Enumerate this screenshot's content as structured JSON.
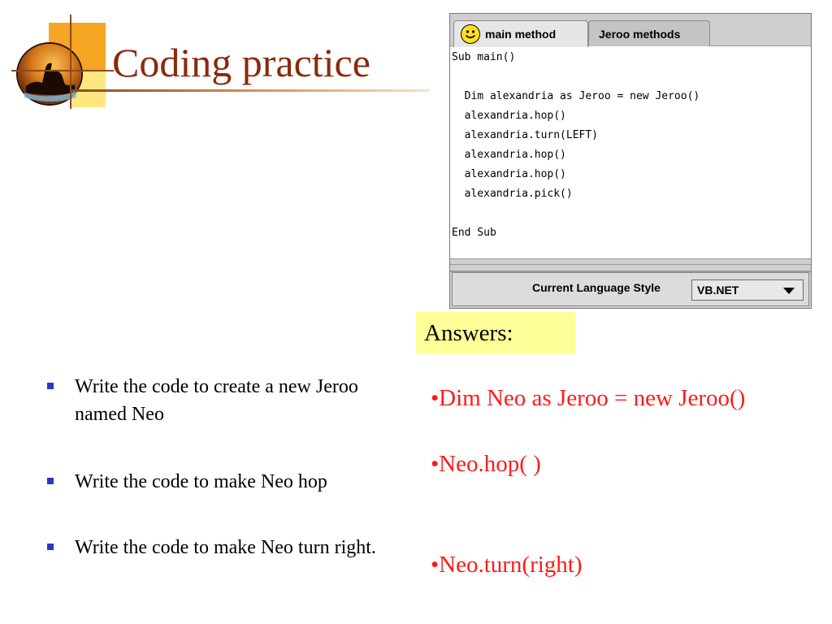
{
  "title": "Coding practice",
  "colors": {
    "title": "#8b2a0d",
    "answer_text": "#ff1a1a",
    "answers_highlight": "#ffff99",
    "bullet": "#2a36c8"
  },
  "app": {
    "tabs": [
      {
        "label": "main method",
        "icon": "smiley-icon",
        "active": true
      },
      {
        "label": "Jeroo methods",
        "active": false
      }
    ],
    "code_lines": [
      "Sub main()",
      "",
      "  Dim alexandria as Jeroo = new Jeroo()",
      "  alexandria.hop()",
      "  alexandria.turn(LEFT)",
      "  alexandria.hop()",
      "  alexandria.hop()",
      "  alexandria.pick()",
      "",
      "End Sub"
    ],
    "language_label": "Current Language Style",
    "language_value": "VB.NET"
  },
  "answers_header": "Answers:",
  "questions": [
    "Write the code to create a new Jeroo named Neo",
    "Write the code to make Neo hop",
    "Write the code to make Neo turn right."
  ],
  "answers": [
    "•Dim Neo as Jeroo = new Jeroo()",
    "•Neo.hop( )",
    "•Neo.turn(right)"
  ]
}
